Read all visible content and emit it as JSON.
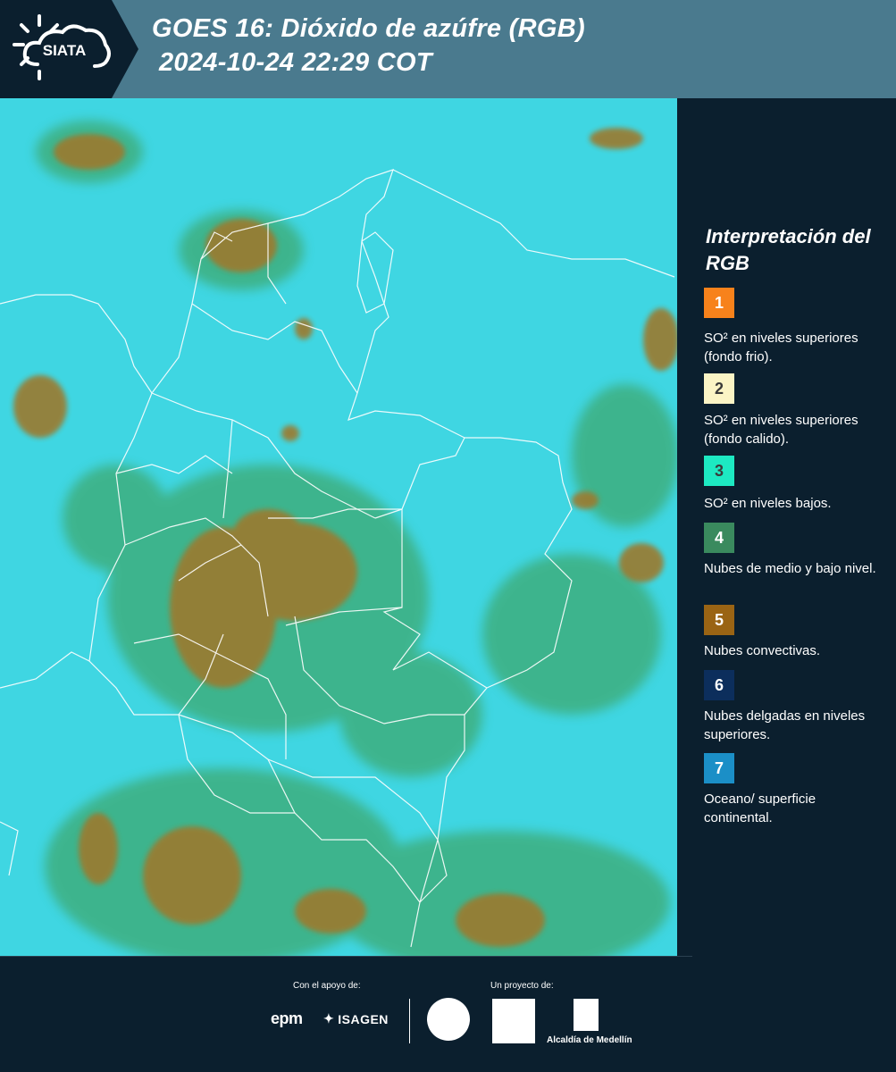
{
  "header": {
    "logo_text": "SIATA",
    "title_line1": "GOES 16: Dióxido de azúfre (RGB)",
    "title_line2": "2024-10-24 22:29 COT"
  },
  "legend": {
    "title": "Interpretación del RGB",
    "items": [
      {
        "number": "1",
        "label": "SO² en niveles superiores (fondo frio).",
        "color": "#f7821b"
      },
      {
        "number": "2",
        "label": "SO² en niveles superiores (fondo calido).",
        "color": "#fbf4c5"
      },
      {
        "number": "3",
        "label": "SO² en niveles bajos.",
        "color": "#1de9c2"
      },
      {
        "number": "4",
        "label": "Nubes de medio y bajo nivel.",
        "color": "#3a8a5e"
      },
      {
        "number": "5",
        "label": "Nubes convectivas.",
        "color": "#9a6414"
      },
      {
        "number": "6",
        "label": "Nubes delgadas en niveles superiores.",
        "color": "#0c2e5c"
      },
      {
        "number": "7",
        "label": "Oceano/ superficie continental.",
        "color": "#1b8fc7"
      }
    ]
  },
  "map": {
    "background_color": "#3fd6e2",
    "cloud_colors": [
      "#9c7a2e",
      "#3e8a3e",
      "#7fbf80"
    ],
    "border_color": "#ffffff"
  },
  "footer": {
    "support_label": "Con el apoyo de:",
    "project_label": "Un proyecto de:",
    "epm": "epm",
    "isagen": "ISAGEN",
    "alcaldia": "Alcaldía de Medellín"
  }
}
